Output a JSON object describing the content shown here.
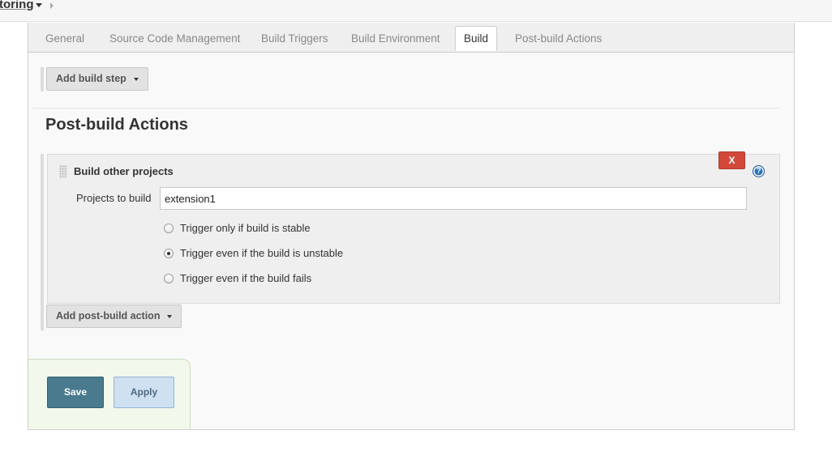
{
  "breadcrumb": {
    "current_label": "toring",
    "caret_icon": "chevron-down-icon",
    "separator_icon": "chevron-right-icon"
  },
  "tabs": [
    {
      "label": "General",
      "active": false
    },
    {
      "label": "Source Code Management",
      "active": false
    },
    {
      "label": "Build Triggers",
      "active": false
    },
    {
      "label": "Build Environment",
      "active": false
    },
    {
      "label": "Build",
      "active": true
    },
    {
      "label": "Post-build Actions",
      "active": false
    }
  ],
  "build": {
    "add_build_step_label": "Add build step"
  },
  "post_build": {
    "title": "Post-build Actions",
    "step": {
      "title": "Build other projects",
      "delete_label": "X",
      "help_label": "?",
      "projects_label": "Projects to build",
      "projects_value": "extension1",
      "options": [
        {
          "label": "Trigger only if build is stable",
          "checked": false
        },
        {
          "label": "Trigger even if the build is unstable",
          "checked": true
        },
        {
          "label": "Trigger even if the build fails",
          "checked": false
        }
      ]
    },
    "add_action_label": "Add post-build action"
  },
  "footer": {
    "save_label": "Save",
    "apply_label": "Apply"
  },
  "colors": {
    "save_button": "#497a8e",
    "apply_button": "#cfe0f1",
    "delete_button": "#d24939",
    "help_icon": "#2b6fb8"
  }
}
